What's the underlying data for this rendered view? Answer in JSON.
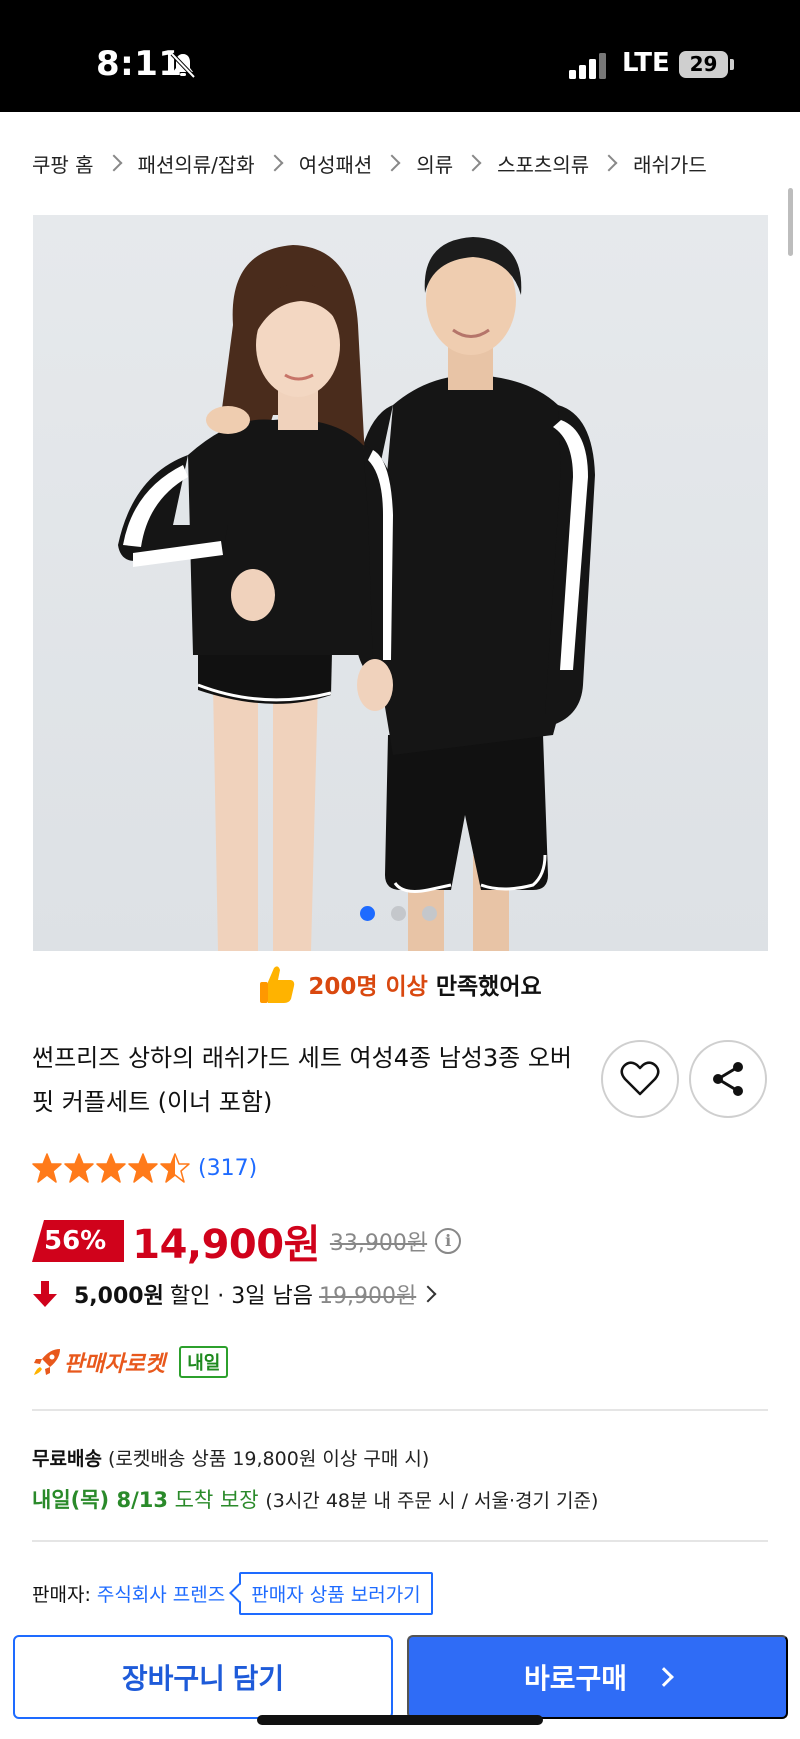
{
  "status_bar": {
    "time": "8:11",
    "network": "LTE",
    "battery": "29"
  },
  "breadcrumb": [
    "쿠팡 홈",
    "패션의류/잡화",
    "여성패션",
    "의류",
    "스포츠의류",
    "래쉬가드"
  ],
  "gallery": {
    "image_count": 3,
    "active_index": 0,
    "active_color": "#1e6bff"
  },
  "satisfaction": {
    "icon": "thumbs-up-icon",
    "highlight": "200명 이상",
    "text": "만족했어요"
  },
  "product": {
    "title": "썬프리즈 상하의 래쉬가드 세트 여성4종 남성3종 오버핏 커플세트 (이너 포함)",
    "rating_stars": 4.5,
    "rating_count": "(317)"
  },
  "actions": {
    "wishlist_icon": "heart-icon",
    "share_icon": "share-icon"
  },
  "price": {
    "discount": "56%",
    "sale": "14,900원",
    "original": "33,900원",
    "brand_color": "#d0021b"
  },
  "coupon": {
    "amount": "5,000원",
    "text": "할인 · 3일 남음",
    "strike_price": "19,900원"
  },
  "delivery": {
    "rocket_label": "판매자로켓",
    "badge": "내일",
    "free_label": "무료배송",
    "free_detail": "(로켓배송 상품 19,800원 이상 구매 시)",
    "eta_bold": "내일(목) 8/13",
    "eta_text": "도착 보장",
    "eta_note": "(3시간 48분 내 주문 시 / 서울·경기 기준)"
  },
  "seller": {
    "label": "판매자:",
    "name": "주식회사 프렌즈",
    "link": "판매자 상품 보러가기"
  },
  "bottom_bar": {
    "cart": "장바구니 담기",
    "buy": "바로구매",
    "accent": "#2f6cf6"
  }
}
